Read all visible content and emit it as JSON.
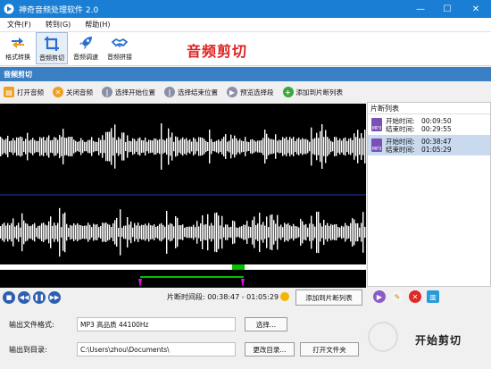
{
  "window": {
    "title": "神奇音频处理软件 2.0",
    "minimize": "—",
    "maximize": "☐",
    "close": "✕"
  },
  "menu": [
    "文件(F)",
    "转到(G)",
    "帮助(H)"
  ],
  "toolbar": {
    "items": [
      {
        "label": "格式转换",
        "icon": "convert-icon"
      },
      {
        "label": "音频剪切",
        "icon": "crop-icon",
        "active": true
      },
      {
        "label": "音频调速",
        "icon": "rocket-icon"
      },
      {
        "label": "音频拼接",
        "icon": "handshake-icon"
      }
    ],
    "heading": "音频剪切"
  },
  "section_title": "音频剪切",
  "actions": [
    {
      "label": "打开音频",
      "color": "#f0a020",
      "glyph": "▤"
    },
    {
      "label": "关闭音频",
      "color": "#f0a020",
      "glyph": "✕"
    },
    {
      "label": "选择开始位置",
      "color": "#8a8fa8",
      "glyph": "|"
    },
    {
      "label": "选择结束位置",
      "color": "#8a8fa8",
      "glyph": "|"
    },
    {
      "label": "预览选择段",
      "color": "#8a8fa8",
      "glyph": "▶"
    },
    {
      "label": "添加到片断列表",
      "color": "#3aa83a",
      "glyph": "+"
    }
  ],
  "segment_list": {
    "header": "片断列表",
    "items": [
      {
        "badge": "MP3",
        "start_label": "开始时间:",
        "start": "00:09:50",
        "end_label": "结束时间:",
        "end": "00:29:55"
      },
      {
        "badge": "MP3",
        "start_label": "开始时间:",
        "start": "00:38:47",
        "end_label": "结束时间:",
        "end": "01:05:29"
      }
    ]
  },
  "controls": {
    "cut_label": "片断时间段: 00:38:47 - 01:05:29",
    "add_button": "添加到片断列表"
  },
  "output": {
    "format_label": "输出文件格式:",
    "format_value": "MP3 高品质 44100Hz",
    "format_button": "选择...",
    "dir_label": "输出到目录:",
    "dir_value": "C:\\Users\\zhou\\Documents\\",
    "change_dir_button": "更改目录...",
    "open_folder_button": "打开文件夹",
    "start_button": "开始剪切"
  },
  "colors": {
    "titlebar": "#1a7fd4",
    "accent_red": "#e02020",
    "section": "#3a7ec4",
    "selection": "#00c000",
    "marker": "#e010e0"
  }
}
